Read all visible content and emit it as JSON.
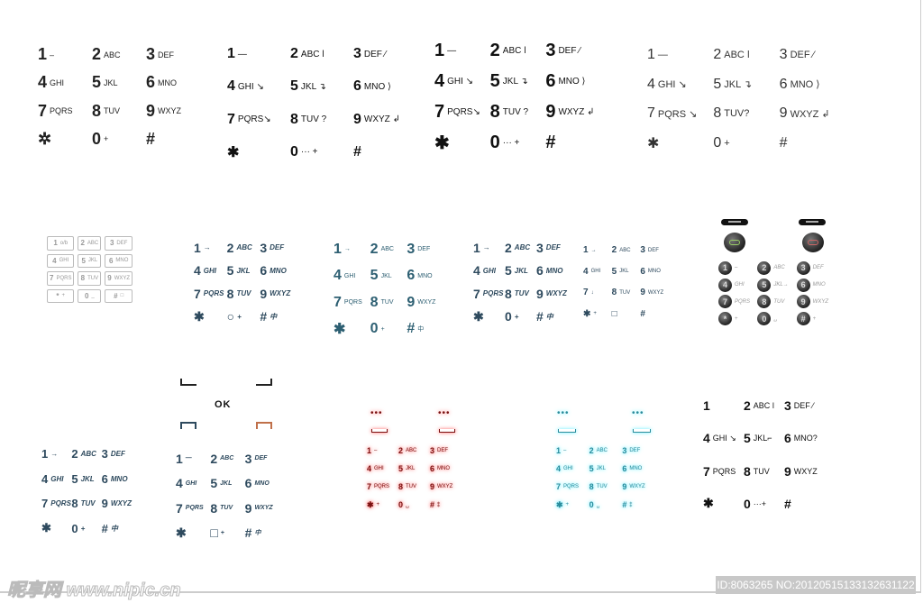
{
  "keypads": [
    {
      "name": "thin-black",
      "color": "#222222",
      "keys": [
        [
          "1",
          "–"
        ],
        [
          "2",
          "ABC"
        ],
        [
          "3",
          "DEF"
        ],
        [
          "4",
          "GHI"
        ],
        [
          "5",
          "JKL"
        ],
        [
          "6",
          "MNO"
        ],
        [
          "7",
          "PQRS"
        ],
        [
          "8",
          "TUV"
        ],
        [
          "9",
          "WXYZ"
        ],
        [
          "✲",
          ""
        ],
        [
          "0",
          "+"
        ],
        [
          "#",
          ""
        ]
      ]
    },
    {
      "name": "bold-black",
      "color": "#111111",
      "keys": [
        [
          "1",
          "—"
        ],
        [
          "2",
          "ABC ǀ"
        ],
        [
          "3",
          "DEF ⁄"
        ],
        [
          "4",
          "GHI ↘"
        ],
        [
          "5",
          "JKL ↴"
        ],
        [
          "6",
          "MNO ⟩"
        ],
        [
          "7",
          "PQRS↘"
        ],
        [
          "8",
          "TUV ?"
        ],
        [
          "9",
          "WXYZ ↲"
        ],
        [
          "✱",
          ""
        ],
        [
          "0",
          "··· +"
        ],
        [
          "#",
          ""
        ]
      ]
    },
    {
      "name": "condensed-black",
      "color": "#111111",
      "keys": [
        [
          "1",
          "—"
        ],
        [
          "2",
          "ABC ǀ"
        ],
        [
          "3",
          "DEF ⁄"
        ],
        [
          "4",
          "GHI ↘"
        ],
        [
          "5",
          "JKL ↴"
        ],
        [
          "6",
          "MNO ⟩"
        ],
        [
          "7",
          "PQRS↘"
        ],
        [
          "8",
          "TUV ?"
        ],
        [
          "9",
          "WXYZ ↲"
        ],
        [
          "✱",
          ""
        ],
        [
          "0",
          "··· +"
        ],
        [
          "#",
          ""
        ]
      ]
    },
    {
      "name": "light-black",
      "color": "#333333",
      "keys": [
        [
          "1",
          "—"
        ],
        [
          "2",
          "ABC ǀ"
        ],
        [
          "3",
          "DEF ⁄"
        ],
        [
          "4",
          "GHI ↘"
        ],
        [
          "5",
          "JKL ↴"
        ],
        [
          "6",
          "MNO ⟩"
        ],
        [
          "7",
          "PQRS ↘"
        ],
        [
          "8",
          "TUV?"
        ],
        [
          "9",
          "WXYZ ↲"
        ],
        [
          "✱",
          ""
        ],
        [
          "0",
          "+"
        ],
        [
          "#",
          ""
        ]
      ]
    },
    {
      "name": "outlined-grey",
      "color": "#999999",
      "keys": [
        [
          "1",
          "o/b"
        ],
        [
          "2",
          "ABC"
        ],
        [
          "3",
          "DEF"
        ],
        [
          "4",
          "GHI"
        ],
        [
          "5",
          "JKL"
        ],
        [
          "6",
          "MNO"
        ],
        [
          "7",
          "PQRS"
        ],
        [
          "8",
          "TUV"
        ],
        [
          "9",
          "WXYZ"
        ],
        [
          "*",
          "+"
        ],
        [
          "0",
          "_"
        ],
        [
          "#",
          "□"
        ]
      ]
    },
    {
      "name": "slate-italic",
      "color": "#2e4a5e",
      "keys": [
        [
          "1",
          "→"
        ],
        [
          "2",
          "ABC"
        ],
        [
          "3",
          "DEF"
        ],
        [
          "4",
          "GHI"
        ],
        [
          "5",
          "JKL"
        ],
        [
          "6",
          "MNO"
        ],
        [
          "7",
          "PQRS"
        ],
        [
          "8",
          "TUV"
        ],
        [
          "9",
          "WXYZ"
        ],
        [
          "✱",
          ""
        ],
        [
          "○",
          "+"
        ],
        [
          "#",
          "中"
        ]
      ]
    },
    {
      "name": "teal-thin",
      "color": "#2d5f72",
      "keys": [
        [
          "1",
          "→"
        ],
        [
          "2",
          "ABC"
        ],
        [
          "3",
          "DEF"
        ],
        [
          "4",
          "GHI"
        ],
        [
          "5",
          "JKL"
        ],
        [
          "6",
          "MNO"
        ],
        [
          "7",
          "PQRS"
        ],
        [
          "8",
          "TUV"
        ],
        [
          "9",
          "WXYZ"
        ],
        [
          "✱",
          ""
        ],
        [
          "0",
          "+"
        ],
        [
          "#",
          "中"
        ]
      ]
    },
    {
      "name": "slate-italic-2",
      "color": "#2e4a5e",
      "keys": [
        [
          "1",
          "→"
        ],
        [
          "2",
          "ABC"
        ],
        [
          "3",
          "DEF"
        ],
        [
          "4",
          "GHI"
        ],
        [
          "5",
          "JKL"
        ],
        [
          "6",
          "MNO"
        ],
        [
          "7",
          "PQRS"
        ],
        [
          "8",
          "TUV"
        ],
        [
          "9",
          "WXYZ"
        ],
        [
          "✱",
          ""
        ],
        [
          "0",
          "+"
        ],
        [
          "#",
          "中"
        ]
      ]
    },
    {
      "name": "slate-small",
      "color": "#2e4a5e",
      "keys": [
        [
          "1",
          "→"
        ],
        [
          "2",
          "ABC"
        ],
        [
          "3",
          "DEF"
        ],
        [
          "4",
          "GHI"
        ],
        [
          "5",
          "JKL"
        ],
        [
          "6",
          "MNO"
        ],
        [
          "7",
          "↓"
        ],
        [
          "8",
          "TUV"
        ],
        [
          "9",
          "WXYZ"
        ],
        [
          "✱",
          "+"
        ],
        [
          "□",
          ""
        ],
        [
          "#",
          ""
        ]
      ]
    },
    {
      "name": "dark-ball",
      "color": "#222222",
      "keys": [
        [
          "1",
          "–"
        ],
        [
          "2",
          "ABC"
        ],
        [
          "3",
          "DEF"
        ],
        [
          "4",
          "GHI"
        ],
        [
          "5",
          "JKL→"
        ],
        [
          "6",
          "MNO"
        ],
        [
          "7",
          "PQRS"
        ],
        [
          "8",
          "TUV"
        ],
        [
          "9",
          "WXYZ"
        ],
        [
          "*",
          "+"
        ],
        [
          "0",
          "␣"
        ],
        [
          "#",
          "+"
        ]
      ]
    },
    {
      "name": "slate-superscript",
      "color": "#2e4a5e",
      "keys": [
        [
          "1",
          "→"
        ],
        [
          "2",
          "ABC"
        ],
        [
          "3",
          "DEF"
        ],
        [
          "4",
          "GHI"
        ],
        [
          "5",
          "JKL"
        ],
        [
          "6",
          "MNO"
        ],
        [
          "7",
          "PQRS"
        ],
        [
          "8",
          "TUV"
        ],
        [
          "9",
          "WXYZ"
        ],
        [
          "✱",
          ""
        ],
        [
          "0",
          "+"
        ],
        [
          "#",
          "中"
        ]
      ]
    },
    {
      "name": "digital-slate",
      "color": "#2e4a5e",
      "keys": [
        [
          "1",
          "—"
        ],
        [
          "2",
          "ABC"
        ],
        [
          "3",
          "DEF"
        ],
        [
          "4",
          "GHI"
        ],
        [
          "5",
          "JKL"
        ],
        [
          "6",
          "MNO"
        ],
        [
          "7",
          "PQRS"
        ],
        [
          "8",
          "TUV"
        ],
        [
          "9",
          "WXYZ"
        ],
        [
          "✱",
          ""
        ],
        [
          "□",
          "+"
        ],
        [
          "#",
          "中"
        ]
      ]
    },
    {
      "name": "glow-red",
      "color": "#7a1010",
      "keys": [
        [
          "1",
          "–"
        ],
        [
          "2",
          "ABC"
        ],
        [
          "3",
          "DEF"
        ],
        [
          "4",
          "GHI"
        ],
        [
          "5",
          "JKL"
        ],
        [
          "6",
          "MNO"
        ],
        [
          "7",
          "PQRS"
        ],
        [
          "8",
          "TUV"
        ],
        [
          "9",
          "WXYZ"
        ],
        [
          "✱",
          "+"
        ],
        [
          "0",
          "␣"
        ],
        [
          "#",
          "⁑"
        ]
      ]
    },
    {
      "name": "glow-cyan",
      "color": "#2a8c9c",
      "keys": [
        [
          "1",
          "–"
        ],
        [
          "2",
          "ABC"
        ],
        [
          "3",
          "DEF"
        ],
        [
          "4",
          "GHI"
        ],
        [
          "5",
          "JKL"
        ],
        [
          "6",
          "MNO"
        ],
        [
          "7",
          "PQRS"
        ],
        [
          "8",
          "TUV"
        ],
        [
          "9",
          "WXYZ"
        ],
        [
          "✱",
          "+"
        ],
        [
          "0",
          "␣"
        ],
        [
          "#",
          "⁑"
        ]
      ]
    },
    {
      "name": "digital-black",
      "color": "#111111",
      "keys": [
        [
          "1",
          ""
        ],
        [
          "2",
          "ABC ǀ"
        ],
        [
          "3",
          "DEF ⁄"
        ],
        [
          "4",
          "GHI ↘"
        ],
        [
          "5",
          "JKL⌐"
        ],
        [
          "6",
          "MNO?"
        ],
        [
          "7",
          "PQRS"
        ],
        [
          "8",
          "TUV"
        ],
        [
          "9",
          "WXYZ"
        ],
        [
          "✱",
          ""
        ],
        [
          "0",
          "···+"
        ],
        [
          "#",
          ""
        ]
      ]
    }
  ],
  "ok_label": "OK",
  "soft_dots": "•••",
  "footer": {
    "watermark": "昵享网 www.nipic.cn",
    "id_text": "ID:8063265 NO:20120515133132631122"
  },
  "colors": {
    "red_glow": "#ff6666",
    "cyan_glow": "#66eeff",
    "slate": "#2e4a5e"
  }
}
